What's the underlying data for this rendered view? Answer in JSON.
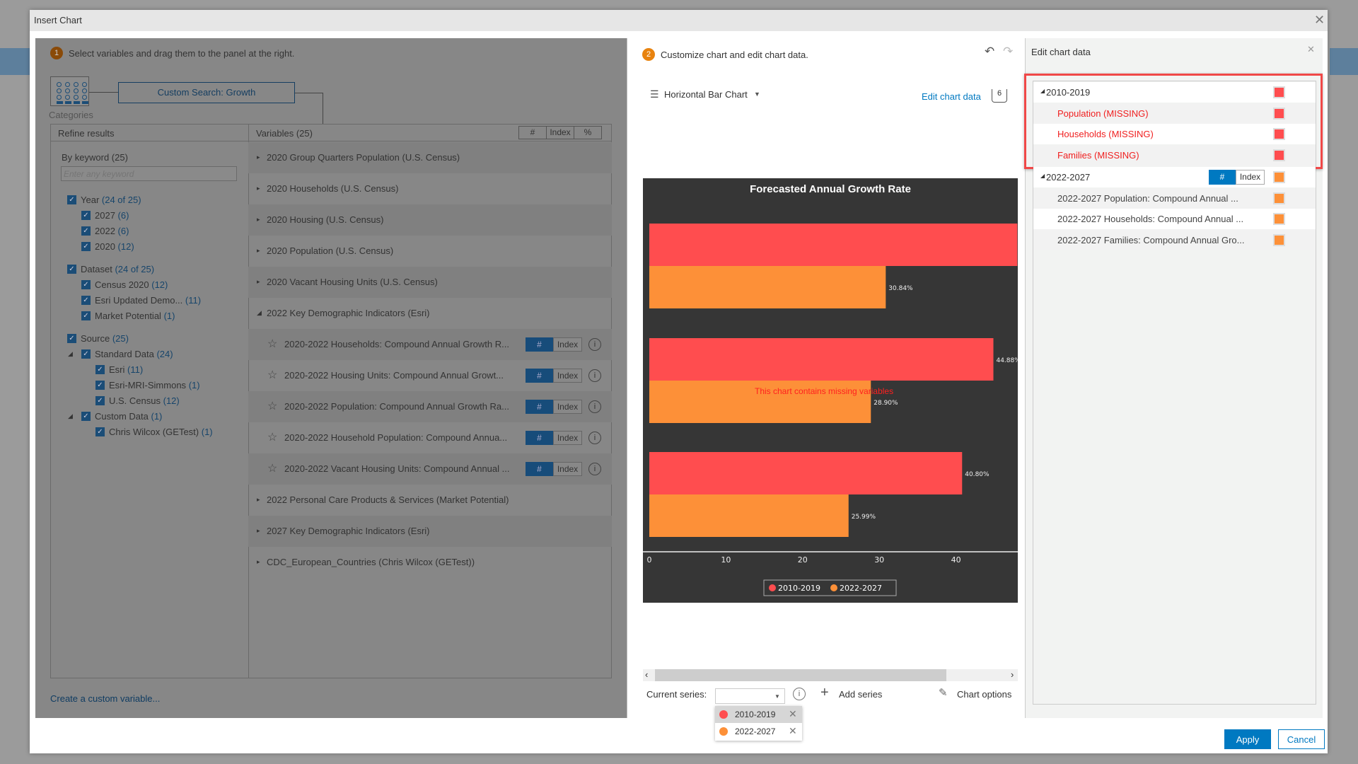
{
  "dialog": {
    "title": "Insert Chart"
  },
  "left": {
    "step_number": "1",
    "step_text": "Select variables and drag them to the panel at the right.",
    "categories_label": "Categories",
    "custom_search": "Custom Search: Growth",
    "refine_header": "Refine results",
    "variables_header": "Variables (25)",
    "header_buttons": [
      "#",
      "Index",
      "%"
    ],
    "keyword_label": "By keyword (25)",
    "keyword_placeholder": "Enter any keyword",
    "filters": [
      {
        "label": "Year",
        "count": "(24 of 25)",
        "level": 0,
        "checked": true
      },
      {
        "label": "2027",
        "count": "(6)",
        "level": 1,
        "checked": true
      },
      {
        "label": "2022",
        "count": "(6)",
        "level": 1,
        "checked": true
      },
      {
        "label": "2020",
        "count": "(12)",
        "level": 1,
        "checked": true
      },
      {
        "label": "Dataset",
        "count": "(24 of 25)",
        "level": 0,
        "checked": true,
        "gap": true
      },
      {
        "label": "Census 2020",
        "count": "(12)",
        "level": 1,
        "checked": true
      },
      {
        "label": "Esri Updated Demo...",
        "count": "(11)",
        "level": 1,
        "checked": true
      },
      {
        "label": "Market Potential",
        "count": "(1)",
        "level": 1,
        "checked": true
      },
      {
        "label": "Source",
        "count": "(25)",
        "level": 0,
        "checked": true,
        "gap": true
      },
      {
        "label": "Standard Data",
        "count": "(24)",
        "level": 1,
        "checked": true,
        "expanded": true
      },
      {
        "label": "Esri",
        "count": "(11)",
        "level": 2,
        "checked": true
      },
      {
        "label": "Esri-MRI-Simmons",
        "count": "(1)",
        "level": 2,
        "checked": true
      },
      {
        "label": "U.S. Census",
        "count": "(12)",
        "level": 2,
        "checked": true
      },
      {
        "label": "Custom Data",
        "count": "(1)",
        "level": 1,
        "checked": true,
        "expanded": true
      },
      {
        "label": "Chris Wilcox (GETest)",
        "count": "(1)",
        "level": 2,
        "checked": true
      }
    ],
    "variables": [
      {
        "label": "2020 Group Quarters Population (U.S. Census)",
        "type": "group",
        "expanded": false
      },
      {
        "label": "2020 Households (U.S. Census)",
        "type": "group",
        "expanded": false
      },
      {
        "label": "2020 Housing (U.S. Census)",
        "type": "group",
        "expanded": false
      },
      {
        "label": "2020 Population (U.S. Census)",
        "type": "group",
        "expanded": false
      },
      {
        "label": "2020 Vacant Housing Units (U.S. Census)",
        "type": "group",
        "expanded": false
      },
      {
        "label": "2022 Key Demographic Indicators (Esri)",
        "type": "group",
        "expanded": true
      },
      {
        "label": "2020-2022 Households: Compound Annual Growth R...",
        "type": "item"
      },
      {
        "label": "2020-2022 Housing Units: Compound Annual Growt...",
        "type": "item"
      },
      {
        "label": "2020-2022 Population: Compound Annual Growth Ra...",
        "type": "item"
      },
      {
        "label": "2020-2022 Household Population: Compound Annua...",
        "type": "item"
      },
      {
        "label": "2020-2022 Vacant Housing Units: Compound Annual ...",
        "type": "item"
      },
      {
        "label": "2022 Personal Care Products & Services (Market Potential)",
        "type": "group",
        "expanded": false
      },
      {
        "label": "2027 Key Demographic Indicators (Esri)",
        "type": "group",
        "expanded": false
      },
      {
        "label": "CDC_European_Countries (Chris Wilcox (GETest))",
        "type": "group",
        "expanded": false
      }
    ],
    "item_buttons": {
      "hash": "#",
      "index": "Index"
    },
    "create_custom": "Create a custom variable..."
  },
  "middle": {
    "step_number": "2",
    "step_text": "Customize chart and edit chart data.",
    "chart_type": "Horizontal Bar Chart",
    "edit_chart_data": "Edit chart data",
    "edit_count": "6",
    "missing_warning": "This chart contains missing variables",
    "current_series_label": "Current series:",
    "current_series_value": "",
    "add_series": "Add series",
    "chart_options": "Chart options",
    "series_dropdown": [
      {
        "label": "2010-2019",
        "color": "#ff4d4f",
        "highlighted": true
      },
      {
        "label": "2022-2027",
        "color": "#fd9038",
        "highlighted": false
      }
    ]
  },
  "chart_data": {
    "type": "bar",
    "orientation": "horizontal",
    "title": "Forecasted Annual Growth Rate",
    "categories": [
      "",
      "",
      ""
    ],
    "series": [
      {
        "name": "2010-2019",
        "color": "#ff4d4f",
        "values": [
          48.0,
          44.88,
          40.8
        ],
        "labels": [
          "",
          "44.88%",
          "40.80%"
        ]
      },
      {
        "name": "2022-2027",
        "color": "#fd9038",
        "values": [
          30.84,
          28.9,
          25.99
        ],
        "labels": [
          "30.84%",
          "28.90%",
          "25.99%"
        ]
      }
    ],
    "xticks": [
      0,
      10,
      20,
      30,
      40
    ],
    "xlim": [
      0,
      48.9
    ],
    "legend": "bottom",
    "background": "#363636"
  },
  "right": {
    "title": "Edit chart data",
    "groups": [
      {
        "label": "2010-2019",
        "color": "#ff4d4f",
        "items": [
          {
            "label": "Population (MISSING)",
            "missing": true
          },
          {
            "label": "Households (MISSING)",
            "missing": true
          },
          {
            "label": "Families (MISSING)",
            "missing": true
          }
        ]
      },
      {
        "label": "2022-2027",
        "color": "#fd9038",
        "toggle": [
          "#",
          "Index"
        ],
        "items": [
          {
            "label": "2022-2027 Population: Compound Annual ...",
            "missing": false
          },
          {
            "label": "2022-2027 Households: Compound Annual ...",
            "missing": false
          },
          {
            "label": "2022-2027 Families: Compound Annual Gro...",
            "missing": false
          }
        ]
      }
    ],
    "highlight_color": "#f04848"
  },
  "footer": {
    "apply": "Apply",
    "cancel": "Cancel"
  },
  "colors": {
    "accent": "#0079c1",
    "step": "#e8830f"
  }
}
